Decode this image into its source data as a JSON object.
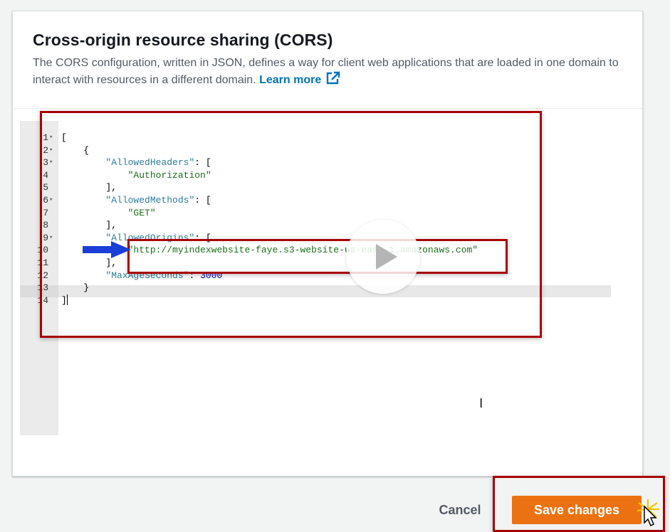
{
  "modal": {
    "title": "Cross-origin resource sharing (CORS)",
    "description": "The CORS configuration, written in JSON, defines a way for client web applications that are loaded in one domain to interact with resources in a different domain.",
    "learn_more": "Learn more",
    "external_icon": "external-link-icon"
  },
  "editor": {
    "lines": [
      {
        "n": "1",
        "fold": true,
        "parts": [
          {
            "t": "[",
            "c": ""
          }
        ]
      },
      {
        "n": "2",
        "fold": true,
        "parts": [
          {
            "t": "    {",
            "c": ""
          }
        ]
      },
      {
        "n": "3",
        "fold": true,
        "parts": [
          {
            "t": "        ",
            "c": ""
          },
          {
            "t": "\"AllowedHeaders\"",
            "c": "key"
          },
          {
            "t": ": [",
            "c": ""
          }
        ]
      },
      {
        "n": "4",
        "fold": false,
        "parts": [
          {
            "t": "            ",
            "c": ""
          },
          {
            "t": "\"Authorization\"",
            "c": "str"
          }
        ]
      },
      {
        "n": "5",
        "fold": false,
        "parts": [
          {
            "t": "        ],",
            "c": ""
          }
        ]
      },
      {
        "n": "6",
        "fold": true,
        "parts": [
          {
            "t": "        ",
            "c": ""
          },
          {
            "t": "\"AllowedMethods\"",
            "c": "key"
          },
          {
            "t": ": [",
            "c": ""
          }
        ]
      },
      {
        "n": "7",
        "fold": false,
        "parts": [
          {
            "t": "            ",
            "c": ""
          },
          {
            "t": "\"GET\"",
            "c": "str"
          }
        ]
      },
      {
        "n": "8",
        "fold": false,
        "parts": [
          {
            "t": "        ],",
            "c": ""
          }
        ]
      },
      {
        "n": "9",
        "fold": true,
        "parts": [
          {
            "t": "        ",
            "c": ""
          },
          {
            "t": "\"AllowedOrigins\"",
            "c": "key"
          },
          {
            "t": ": [",
            "c": ""
          }
        ]
      },
      {
        "n": "10",
        "fold": false,
        "parts": [
          {
            "t": "            ",
            "c": ""
          },
          {
            "t": "\"http://myindexwebsite-faye.s3-website-us-east-1.amazonaws.com\"",
            "c": "str"
          }
        ]
      },
      {
        "n": "11",
        "fold": false,
        "parts": [
          {
            "t": "        ],",
            "c": ""
          }
        ]
      },
      {
        "n": "12",
        "fold": false,
        "parts": [
          {
            "t": "        ",
            "c": ""
          },
          {
            "t": "\"MaxAgeSeconds\"",
            "c": "key"
          },
          {
            "t": ": ",
            "c": ""
          },
          {
            "t": "3000",
            "c": "num"
          }
        ]
      },
      {
        "n": "13",
        "fold": false,
        "parts": [
          {
            "t": "    }",
            "c": ""
          }
        ]
      },
      {
        "n": "14",
        "fold": false,
        "parts": [
          {
            "t": "]",
            "c": ""
          }
        ]
      }
    ],
    "active_line": "14"
  },
  "footer": {
    "cancel_label": "Cancel",
    "save_label": "Save changes"
  },
  "overlay": {
    "play_icon": "play-icon",
    "arrow_icon": "arrow-right-icon",
    "annotation_color": "#a80000",
    "arrow_color": "#1a3fd6"
  },
  "colors": {
    "primary_button": "#ec7211",
    "link": "#0073bb"
  }
}
